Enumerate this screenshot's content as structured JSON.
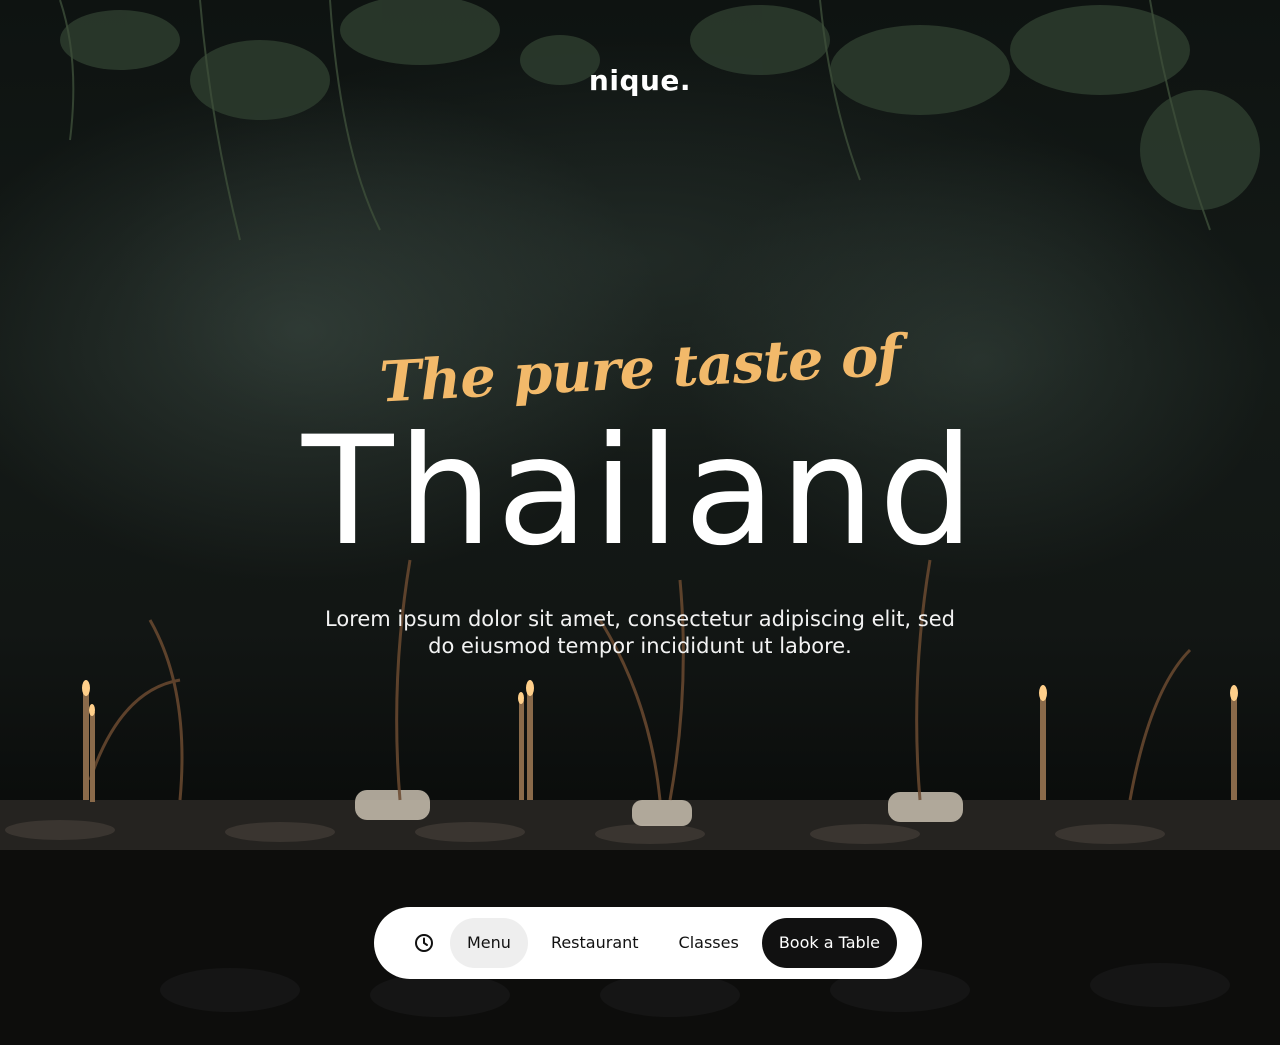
{
  "brand": {
    "logo_text": "nique."
  },
  "hero": {
    "tagline": "The pure taste of",
    "headline": "Thailand",
    "subtitle": "Lorem ipsum dolor sit amet, consectetur adipiscing elit, sed do eiusmod tempor incididunt ut labore."
  },
  "nav": {
    "items": [
      {
        "label": "Menu"
      },
      {
        "label": "Restaurant"
      },
      {
        "label": "Classes"
      }
    ],
    "active_index": 0,
    "cta_label": "Book a Table"
  },
  "colors": {
    "accent": "#f2b96a",
    "nav_background": "#ffffff",
    "cta_background": "#111111",
    "active_pill": "#eeeeee"
  },
  "icons": {
    "nav_clock": "clock-icon"
  }
}
